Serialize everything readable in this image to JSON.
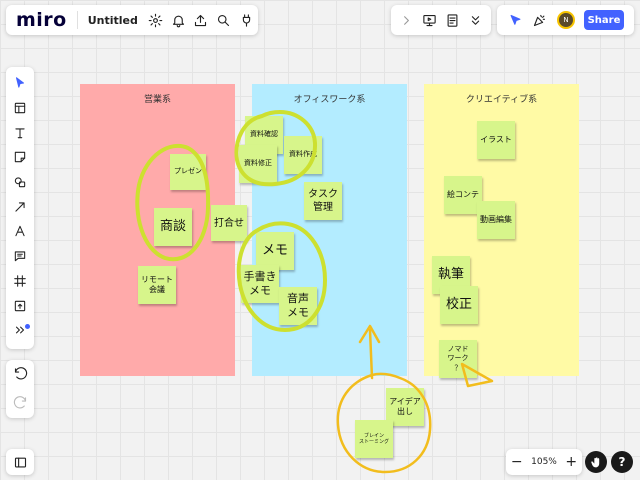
{
  "app": {
    "logo": "miro",
    "board_title": "Untitled"
  },
  "header": {
    "left_icons": [
      "settings-icon",
      "bell-icon",
      "upload-icon",
      "search-icon",
      "plug-icon"
    ],
    "mid_icons": [
      "chevron-right-icon",
      "present-icon",
      "notes-icon",
      "chevrons-down-icon"
    ],
    "right_icons": [
      "cursor-arrow-icon",
      "party-icon"
    ],
    "avatar_initial": "N",
    "share_label": "Share"
  },
  "toolbar": {
    "items": [
      "select-icon",
      "templates-icon",
      "text-icon",
      "sticky-note-icon",
      "shapes-icon",
      "arrow-icon",
      "pen-icon",
      "comment-icon",
      "frame-icon",
      "upload-icon",
      "more-icon"
    ]
  },
  "zoom": {
    "level": "105%",
    "minus": "−",
    "plus": "+"
  },
  "help": {
    "label": "?"
  },
  "colors": {
    "accent": "#4262ff",
    "frame_red": "#ffaaaa",
    "frame_blue": "#b3ecff",
    "frame_yellow": "#fffaa5",
    "sticky": "#d7f58b",
    "marker": "#cde030",
    "marker_orange": "#f2bd1d"
  },
  "frames": [
    {
      "title": "営業系",
      "color": "#ffaaaa"
    },
    {
      "title": "オフィスワーク系",
      "color": "#b3ecff"
    },
    {
      "title": "クリエイティブ系",
      "color": "#fffaa5"
    }
  ],
  "stickies": [
    {
      "text": "プレゼン"
    },
    {
      "text": "商談"
    },
    {
      "text": "打合せ"
    },
    {
      "text": "リモート\n会議"
    },
    {
      "text": "資料確認"
    },
    {
      "text": "資料修正"
    },
    {
      "text": "資料作成"
    },
    {
      "text": "タスク\n管理"
    },
    {
      "text": "メモ"
    },
    {
      "text": "手書き\nメモ"
    },
    {
      "text": "音声\nメモ"
    },
    {
      "text": "イラスト"
    },
    {
      "text": "絵コンテ"
    },
    {
      "text": "動画編集"
    },
    {
      "text": "執筆"
    },
    {
      "text": "校正"
    },
    {
      "text": "ノマド\nワーク\n？"
    },
    {
      "text": "アイデア\n出し"
    },
    {
      "text": "ブレイン\nストーミング"
    }
  ]
}
